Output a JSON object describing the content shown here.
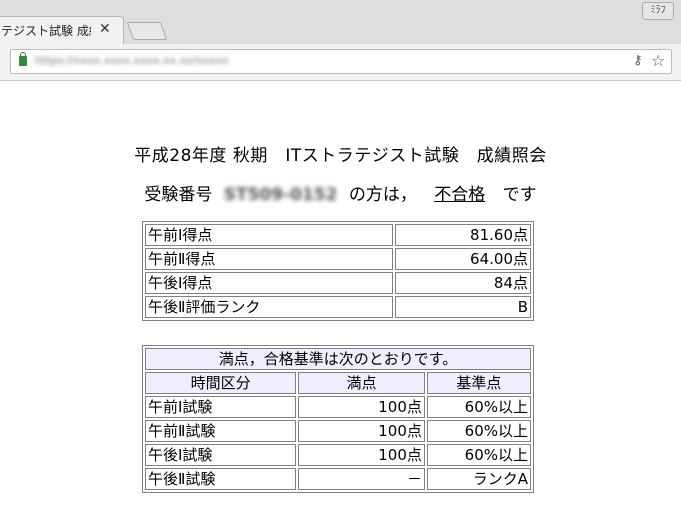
{
  "browser": {
    "tab_title": "テジスト試験 成績",
    "url": "https://xxxx.xxxx.xxxx.xx.xx/xxxxx",
    "profile_label": "ﾐﾗﾌ"
  },
  "page": {
    "heading": "平成28年度 秋期　ITストラテジスト試験　成績照会",
    "exam_prefix": "受験番号",
    "exam_number": "ST509-0152",
    "exam_middle": "の方は，",
    "result": "不合格",
    "exam_suffix": "です"
  },
  "scores": [
    {
      "label": "午前Ⅰ得点",
      "value": "81.60点"
    },
    {
      "label": "午前Ⅱ得点",
      "value": "64.00点"
    },
    {
      "label": "午後Ⅰ得点",
      "value": "84点"
    },
    {
      "label": "午後Ⅱ評価ランク",
      "value": "B"
    }
  ],
  "standards": {
    "caption": "満点，合格基準は次のとおりです。",
    "headers": [
      "時間区分",
      "満点",
      "基準点"
    ],
    "rows": [
      [
        "午前Ⅰ試験",
        "100点",
        "60%以上"
      ],
      [
        "午前Ⅱ試験",
        "100点",
        "60%以上"
      ],
      [
        "午後Ⅰ試験",
        "100点",
        "60%以上"
      ],
      [
        "午後Ⅱ試験",
        "－",
        "ランクA"
      ]
    ]
  }
}
